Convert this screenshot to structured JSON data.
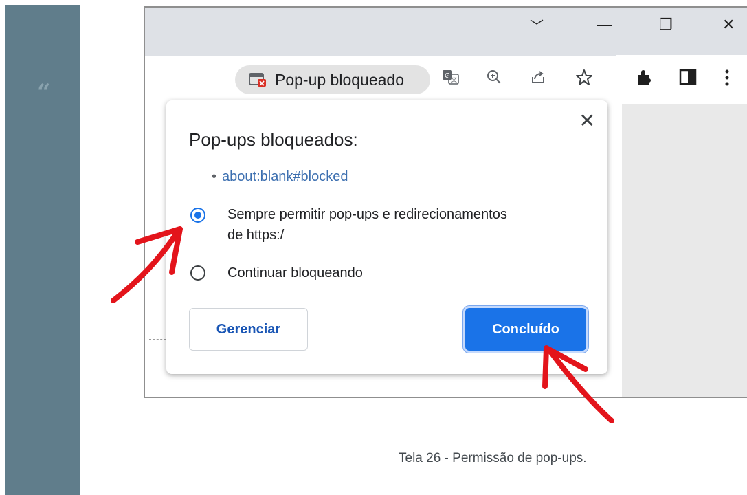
{
  "sidebar": {
    "quote_mark": "“"
  },
  "browser": {
    "window_controls": {
      "tab_list": "﹀",
      "minimize": "—",
      "restore": "❐",
      "close": "✕"
    },
    "toolbar": {
      "popup_chip_label": "Pop-up bloqueado",
      "icons": [
        "translate-icon",
        "zoom-icon",
        "share-icon",
        "star-icon",
        "extensions-icon",
        "side-panel-icon",
        "menu-icon"
      ]
    }
  },
  "popup": {
    "title": "Pop-ups bloqueados:",
    "blocked_link": "about:blank#blocked",
    "options": [
      {
        "label_line1": "Sempre permitir pop-ups e redirecionamentos",
        "label_line2": "de https:/",
        "selected": true
      },
      {
        "label_line1": "Continuar bloqueando",
        "selected": false
      }
    ],
    "manage_button": "Gerenciar",
    "done_button": "Concluído",
    "close": "✕"
  },
  "caption": "Tela 26 - Permissão de pop-ups.",
  "colors": {
    "accent": "#1a73e8",
    "sidebar": "#607d8b",
    "arrow": "#e3141b"
  }
}
